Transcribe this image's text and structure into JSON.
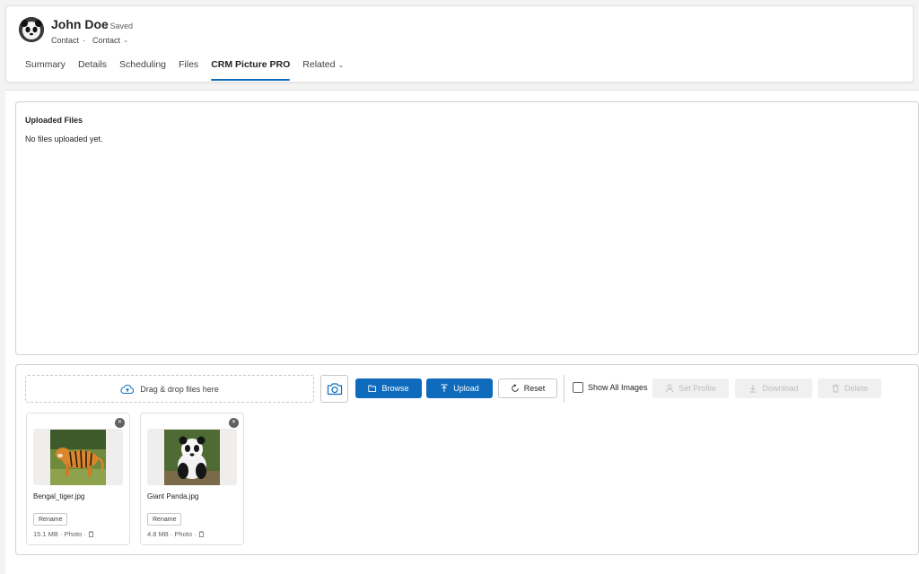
{
  "header": {
    "record_name": "John Doe",
    "saved_status": "- Saved",
    "entity_type": "Contact",
    "separator": "·",
    "form_selector": "Contact"
  },
  "tabs": [
    {
      "label": "Summary"
    },
    {
      "label": "Details"
    },
    {
      "label": "Scheduling"
    },
    {
      "label": "Files"
    },
    {
      "label": "CRM Picture PRO",
      "active": true
    },
    {
      "label": "Related"
    }
  ],
  "uploaded_files": {
    "title": "Uploaded Files",
    "empty_message": "No files uploaded yet."
  },
  "toolbar": {
    "dropzone_label": "Drag & drop files here",
    "browse_label": "Browse",
    "upload_label": "Upload",
    "reset_label": "Reset",
    "show_all_label": "Show All Images",
    "show_all_checked": false,
    "set_profile_label": "Set Profile",
    "download_label": "Download",
    "delete_label": "Delete"
  },
  "images": [
    {
      "name": "Bengal_tiger.jpg",
      "rename_label": "Rename",
      "meta": "15.1 MB · Photo ·"
    },
    {
      "name": "Giant Panda.jpg",
      "rename_label": "Rename",
      "meta": "4.8 MB · Photo ·"
    }
  ],
  "colors": {
    "accent": "#0f6cbd",
    "page_background": "#f3f3f3",
    "disabled_background": "#f0f0f0"
  }
}
